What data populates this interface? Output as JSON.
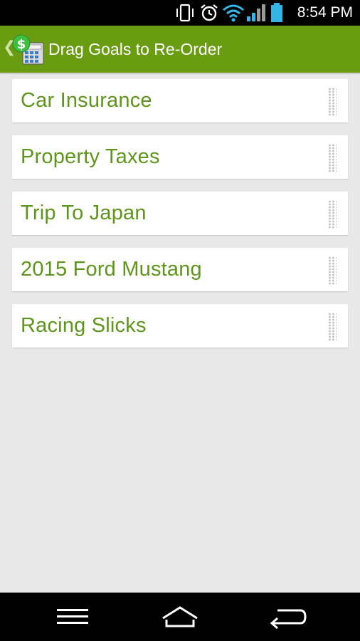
{
  "status_bar": {
    "time": "8:54 PM",
    "icons": [
      "vibrate-icon",
      "alarm-icon",
      "wifi-icon",
      "signal-icon",
      "battery-icon"
    ],
    "wifi_color": "#33b5e5",
    "battery_color": "#33b5e5"
  },
  "app_bar": {
    "title": "Drag Goals to Re-Order",
    "background": "#6a9c12",
    "back_icon": "chevron-left-icon",
    "logo_icon": "dollar-calculator-icon"
  },
  "goals": [
    {
      "label": "Car Insurance"
    },
    {
      "label": "Property Taxes"
    },
    {
      "label": "Trip To Japan"
    },
    {
      "label": "2015 Ford Mustang"
    },
    {
      "label": "Racing Slicks"
    }
  ],
  "goal_text_color": "#5e961b",
  "nav_bar": {
    "buttons": [
      "menu-icon",
      "home-icon",
      "back-arrow-icon"
    ]
  }
}
